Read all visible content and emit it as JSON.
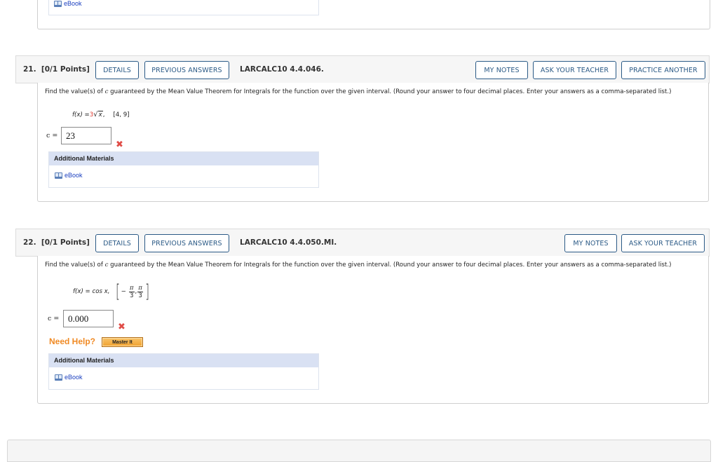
{
  "previous_question": {
    "ebook_label": "eBook"
  },
  "questions": [
    {
      "number": "21.",
      "points": "[0/1 Points]",
      "details_label": "DETAILS",
      "previous_answers_label": "PREVIOUS ANSWERS",
      "code": "LARCALC10 4.4.046.",
      "my_notes_label": "MY NOTES",
      "ask_teacher_label": "ASK YOUR TEACHER",
      "practice_another_label": "PRACTICE ANOTHER",
      "prompt_before": "Find the value(s) of ",
      "prompt_var": "c",
      "prompt_after": " guaranteed by the Mean Value Theorem for Integrals for the function over the given interval. (Round your answer to four decimal places. Enter your answers as a comma-separated list.)",
      "function_lhs": "f(x) = ",
      "function_coef": "3",
      "function_radicand": "x",
      "function_comma": ",",
      "interval": "[4, 9]",
      "answer_label": "c =",
      "answer_value": "23",
      "answer_status": "incorrect",
      "materials_title": "Additional Materials",
      "ebook_label": "eBook"
    },
    {
      "number": "22.",
      "points": "[0/1 Points]",
      "details_label": "DETAILS",
      "previous_answers_label": "PREVIOUS ANSWERS",
      "code": "LARCALC10 4.4.050.MI.",
      "my_notes_label": "MY NOTES",
      "ask_teacher_label": "ASK YOUR TEACHER",
      "prompt_before": "Find the value(s) of ",
      "prompt_var": "c",
      "prompt_after": " guaranteed by the Mean Value Theorem for Integrals for the function over the given interval. (Round your answer to four decimal places. Enter your answers as a comma-separated list.)",
      "function_lhs": "f(x) = cos x,",
      "interval_left_sign": "−",
      "interval_left_num": "π",
      "interval_left_den": "3",
      "interval_right_num": "π",
      "interval_right_den": "3",
      "answer_label": "c =",
      "answer_value": "0.000",
      "answer_status": "incorrect",
      "need_help_label": "Need Help?",
      "master_it_label": "Master It",
      "materials_title": "Additional Materials",
      "ebook_label": "eBook"
    }
  ],
  "colors": {
    "button_border": "#2b5a86",
    "wrong_mark": "#e04c47",
    "need_help": "#f08a24",
    "materials_header": "#d9e1f3",
    "link": "#1a3fbf"
  }
}
